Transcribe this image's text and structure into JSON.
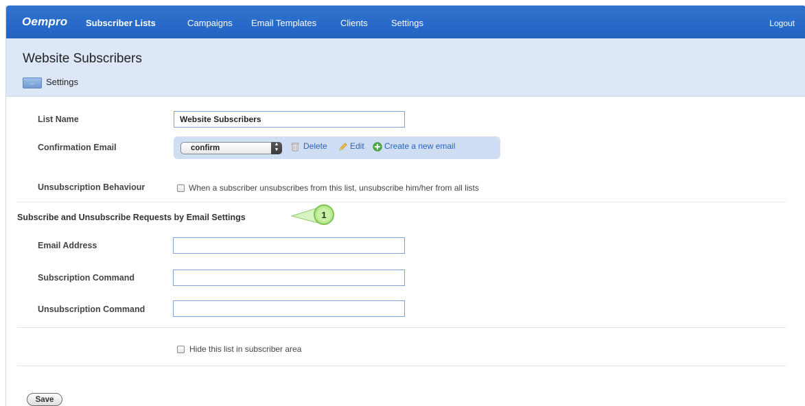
{
  "app": {
    "logo": "Oempro"
  },
  "nav": {
    "items": [
      {
        "label": "Subscriber Lists",
        "active": true
      },
      {
        "label": "Campaigns",
        "active": false
      },
      {
        "label": "Email Templates",
        "active": false
      },
      {
        "label": "Clients",
        "active": false
      },
      {
        "label": "Settings",
        "active": false
      }
    ],
    "logout": "Logout"
  },
  "header": {
    "title": "Website Subscribers",
    "menu_button": "...",
    "subnav": "Settings"
  },
  "form": {
    "list_name": {
      "label": "List Name",
      "value": "Website Subscribers"
    },
    "confirmation_email": {
      "label": "Confirmation Email",
      "selected": "confirm",
      "delete": "Delete",
      "edit": "Edit",
      "create": "Create a new email"
    },
    "unsubscription_behaviour": {
      "label": "Unsubscription Behaviour",
      "checkbox_label": "When a subscriber unsubscribes from this list, unsubscribe him/her from all lists",
      "checked": false
    },
    "section_title": "Subscribe and Unsubscribe Requests by Email Settings",
    "callout_number": "1",
    "email_address": {
      "label": "Email Address",
      "value": ""
    },
    "subscription_command": {
      "label": "Subscription Command",
      "value": ""
    },
    "unsubscription_command": {
      "label": "Unsubscription Command",
      "value": ""
    },
    "hide_list": {
      "label": "Hide this list in subscriber area",
      "checked": false
    },
    "save": "Save"
  },
  "colors": {
    "nav_bg": "#2a6bc9",
    "title_band": "#dce8f7",
    "link": "#2a63b8",
    "callout": "#9ee06a"
  }
}
